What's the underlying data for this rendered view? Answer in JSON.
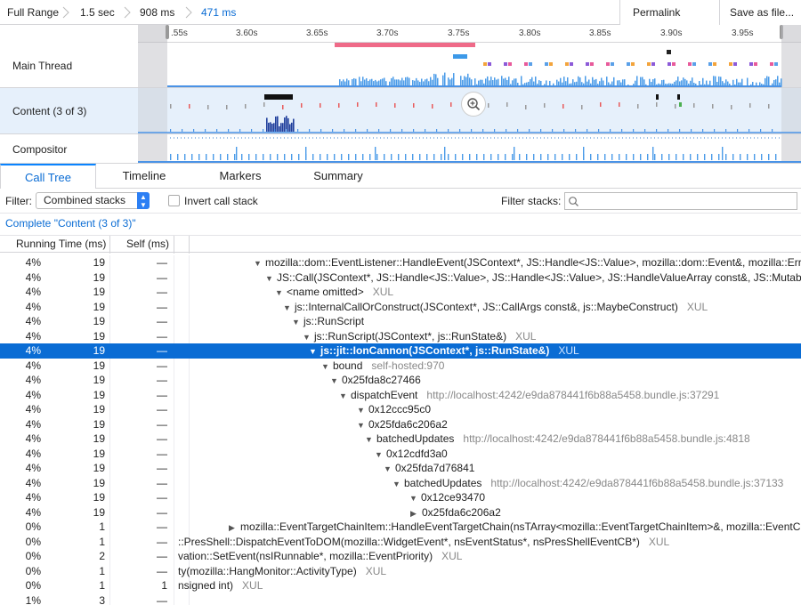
{
  "breadcrumbs": [
    {
      "label": "Full Range",
      "selected": false
    },
    {
      "label": "1.5 sec",
      "selected": false
    },
    {
      "label": "908 ms",
      "selected": false
    },
    {
      "label": "471 ms",
      "selected": true
    }
  ],
  "toolbar": {
    "permalink_label": "Permalink",
    "save_label": "Save as file..."
  },
  "ruler_ticks": [
    ".55s",
    "3.60s",
    "3.65s",
    "3.70s",
    "3.75s",
    "3.80s",
    "3.85s",
    "3.90s",
    "3.95s"
  ],
  "tracks": {
    "main_thread": "Main Thread",
    "content": "Content (3 of 3)",
    "compositor": "Compositor"
  },
  "tabs": [
    {
      "label": "Call Tree",
      "selected": true
    },
    {
      "label": "Timeline",
      "selected": false
    },
    {
      "label": "Markers",
      "selected": false
    },
    {
      "label": "Summary",
      "selected": false
    }
  ],
  "filter": {
    "label": "Filter:",
    "select_value": "Combined stacks",
    "invert_label": "Invert call stack",
    "invert_checked": false,
    "filter_stacks_label": "Filter stacks:",
    "search_placeholder": ""
  },
  "complete_label": "Complete \"Content (3 of 3)\"",
  "tree_columns": {
    "running": "Running Time (ms)",
    "self": "Self (ms)"
  },
  "colors": {
    "accent": "#0a84ff",
    "selection": "#0a6cd4"
  },
  "tree_rows": [
    {
      "pct": "4%",
      "running": "19",
      "self": "—",
      "expanded": true,
      "fn": "mozilla::dom::EventListener::HandleEvent(JSContext*, JS::Handle<JS::Value>, mozilla::dom::Event&, mozilla::Erro",
      "lib": ""
    },
    {
      "pct": "4%",
      "running": "19",
      "self": "—",
      "expanded": true,
      "fn": "JS::Call(JSContext*, JS::Handle<JS::Value>, JS::Handle<JS::Value>, JS::HandleValueArray const&, JS::Mutable",
      "lib": ""
    },
    {
      "pct": "4%",
      "running": "19",
      "self": "—",
      "expanded": true,
      "fn": "<name omitted>",
      "lib": "XUL"
    },
    {
      "pct": "4%",
      "running": "19",
      "self": "—",
      "expanded": true,
      "fn": "js::InternalCallOrConstruct(JSContext*, JS::CallArgs const&, js::MaybeConstruct)",
      "lib": "XUL"
    },
    {
      "pct": "4%",
      "running": "19",
      "self": "—",
      "expanded": true,
      "fn": "js::RunScript",
      "lib": ""
    },
    {
      "pct": "4%",
      "running": "19",
      "self": "—",
      "expanded": true,
      "fn": "js::RunScript(JSContext*, js::RunState&)",
      "lib": "XUL"
    },
    {
      "pct": "4%",
      "running": "19",
      "self": "—",
      "expanded": true,
      "fn": "js::jit::IonCannon(JSContext*, js::RunState&)",
      "lib": "XUL",
      "selected": true
    },
    {
      "pct": "4%",
      "running": "19",
      "self": "—",
      "expanded": true,
      "fn": "bound",
      "lib": "self-hosted:970"
    },
    {
      "pct": "4%",
      "running": "19",
      "self": "—",
      "expanded": true,
      "fn": "0x25fda8c27466",
      "lib": ""
    },
    {
      "pct": "4%",
      "running": "19",
      "self": "—",
      "expanded": true,
      "fn": "dispatchEvent",
      "lib": "http://localhost:4242/e9da878441f6b88a5458.bundle.js:37291"
    },
    {
      "pct": "4%",
      "running": "19",
      "self": "—",
      "expanded": true,
      "fn": "0x12ccc95c0",
      "lib": ""
    },
    {
      "pct": "4%",
      "running": "19",
      "self": "—",
      "expanded": true,
      "fn": "0x25fda6c206a2",
      "lib": ""
    },
    {
      "pct": "4%",
      "running": "19",
      "self": "—",
      "expanded": true,
      "fn": "batchedUpdates",
      "lib": "http://localhost:4242/e9da878441f6b88a5458.bundle.js:4818"
    },
    {
      "pct": "4%",
      "running": "19",
      "self": "—",
      "expanded": true,
      "fn": "0x12cdfd3a0",
      "lib": ""
    },
    {
      "pct": "4%",
      "running": "19",
      "self": "—",
      "expanded": true,
      "fn": "0x25fda7d76841",
      "lib": ""
    },
    {
      "pct": "4%",
      "running": "19",
      "self": "—",
      "expanded": true,
      "fn": "batchedUpdates",
      "lib": "http://localhost:4242/e9da878441f6b88a5458.bundle.js:37133"
    },
    {
      "pct": "4%",
      "running": "19",
      "self": "—",
      "expanded": true,
      "fn": "0x12ce93470",
      "lib": ""
    },
    {
      "pct": "4%",
      "running": "19",
      "self": "—",
      "expanded": false,
      "fn": "0x25fda6c206a2",
      "lib": ""
    },
    {
      "pct": "0%",
      "running": "1",
      "self": "—",
      "expanded": false,
      "fn": "mozilla::EventTargetChainItem::HandleEventTargetChain(nsTArray<mozilla::EventTargetChainItem>&, mozilla::EventCh",
      "lib": ""
    },
    {
      "pct": "0%",
      "running": "1",
      "self": "—",
      "expanded": null,
      "fn": "::PresShell::DispatchEventToDOM(mozilla::WidgetEvent*, nsEventStatus*, nsPresShellEventCB*)",
      "lib": "XUL"
    },
    {
      "pct": "0%",
      "running": "2",
      "self": "—",
      "expanded": null,
      "fn": "vation::SetEvent(nsIRunnable*, mozilla::EventPriority)",
      "lib": "XUL"
    },
    {
      "pct": "0%",
      "running": "1",
      "self": "—",
      "expanded": null,
      "fn": "ty(mozilla::HangMonitor::ActivityType)",
      "lib": "XUL"
    },
    {
      "pct": "0%",
      "running": "1",
      "self": "1",
      "expanded": null,
      "fn": "nsigned int)",
      "lib": "XUL"
    },
    {
      "pct": "1%",
      "running": "3",
      "self": "—",
      "expanded": null,
      "fn": "",
      "lib": ""
    }
  ]
}
